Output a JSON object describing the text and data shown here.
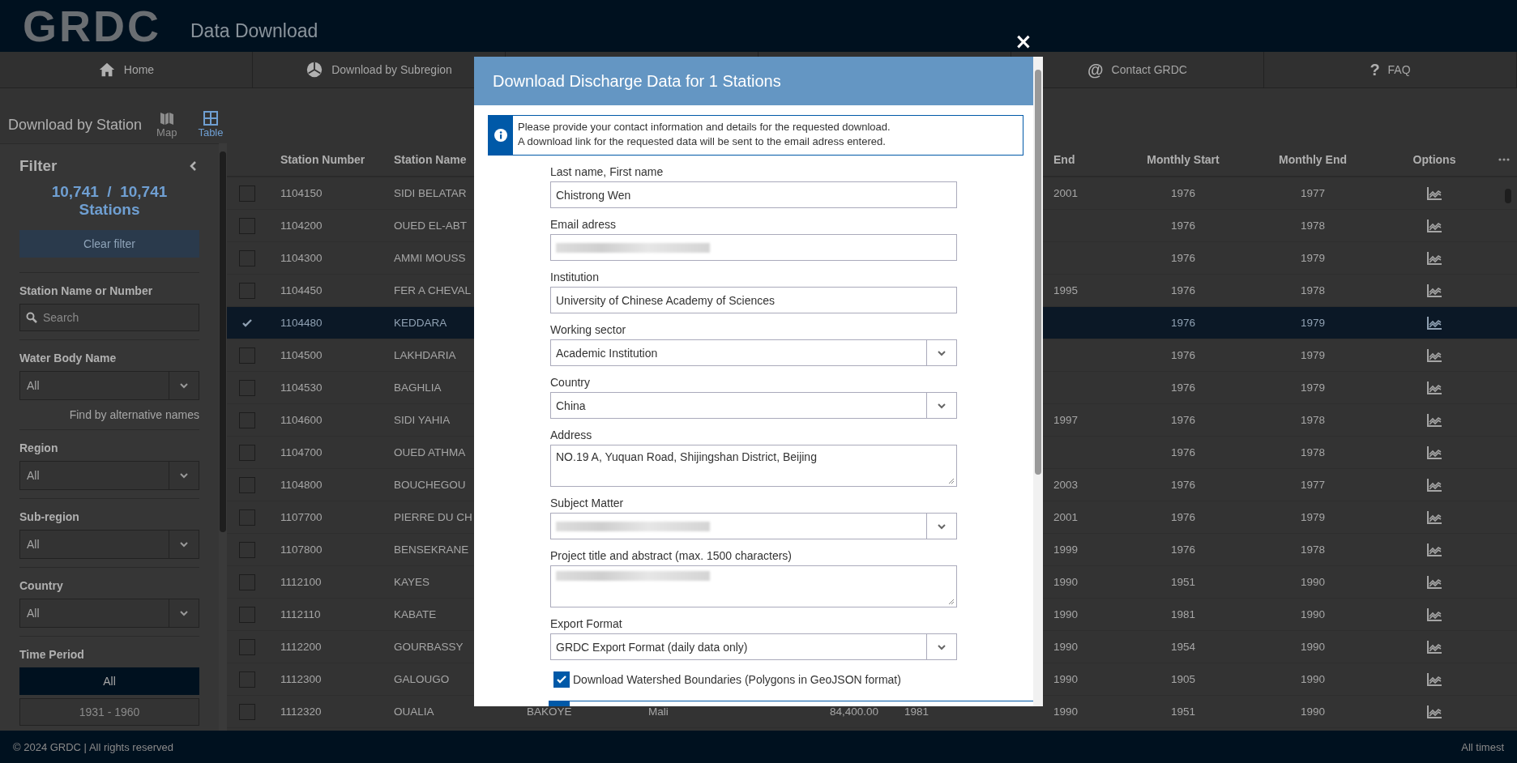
{
  "header": {
    "logo": "GRDC",
    "title": "Data Download"
  },
  "nav": {
    "left": [
      {
        "label": "Home"
      },
      {
        "label": "Download by Subregion"
      }
    ],
    "right": [
      {
        "label": "Contact GRDC",
        "icon_char": "@"
      },
      {
        "label": "FAQ",
        "icon_char": "?"
      }
    ]
  },
  "page_title": "Download by Station",
  "view_toggle": [
    {
      "label": "Map",
      "selected": false
    },
    {
      "label": "Table",
      "selected": true
    }
  ],
  "filter": {
    "title": "Filter",
    "count": "10,741  /  10,741",
    "count_unit": "Stations",
    "clear_button": {
      "label": "Clear filter",
      "disabled": true
    },
    "search": {
      "label": "Station Name or Number",
      "placeholder": "Search"
    },
    "water_body": {
      "label": "Water Body Name",
      "value": "All",
      "link": "Find by alternative names"
    },
    "region": {
      "label": "Region",
      "value": "All"
    },
    "subregion": {
      "label": "Sub-region",
      "value": "All"
    },
    "country": {
      "label": "Country",
      "value": "All"
    },
    "time_period": {
      "label": "Time Period",
      "options": [
        {
          "label": "All",
          "selected": true
        },
        {
          "label": "1931 - 1960",
          "selected": false
        }
      ]
    }
  },
  "table": {
    "columns": [
      "Station Number",
      "Station Name",
      null,
      null,
      null,
      null,
      "End",
      "Monthly Start",
      "Monthly End",
      "Options"
    ],
    "rows": [
      {
        "selected": false,
        "cells": [
          "1104150",
          "SIDI BELATAR",
          null,
          null,
          null,
          null,
          "2001",
          "1976",
          "1977"
        ]
      },
      {
        "selected": false,
        "cells": [
          "1104200",
          "OUED EL-ABT",
          null,
          null,
          null,
          null,
          null,
          "1976",
          "1978"
        ]
      },
      {
        "selected": false,
        "cells": [
          "1104300",
          "AMMI MOUSS",
          null,
          null,
          null,
          null,
          null,
          "1976",
          "1979"
        ]
      },
      {
        "selected": false,
        "cells": [
          "1104450",
          "FER A CHEVAL",
          null,
          null,
          null,
          null,
          "1995",
          "1976",
          "1978"
        ]
      },
      {
        "selected": true,
        "cells": [
          "1104480",
          "KEDDARA",
          null,
          null,
          null,
          null,
          null,
          "1976",
          "1979"
        ]
      },
      {
        "selected": false,
        "cells": [
          "1104500",
          "LAKHDARIA",
          null,
          null,
          null,
          null,
          null,
          "1976",
          "1979"
        ]
      },
      {
        "selected": false,
        "cells": [
          "1104530",
          "BAGHLIA",
          null,
          null,
          null,
          null,
          null,
          "1976",
          "1979"
        ]
      },
      {
        "selected": false,
        "cells": [
          "1104600",
          "SIDI YAHIA",
          null,
          null,
          null,
          null,
          "1997",
          "1976",
          "1978"
        ]
      },
      {
        "selected": false,
        "cells": [
          "1104700",
          "OUED ATHMA",
          null,
          null,
          null,
          null,
          null,
          "1976",
          "1978"
        ]
      },
      {
        "selected": false,
        "cells": [
          "1104800",
          "BOUCHEGOU",
          null,
          null,
          null,
          null,
          "2003",
          "1976",
          "1977"
        ]
      },
      {
        "selected": false,
        "cells": [
          "1107700",
          "PIERRE DU CH",
          null,
          null,
          null,
          null,
          "2001",
          "1976",
          "1979"
        ]
      },
      {
        "selected": false,
        "cells": [
          "1107800",
          "BENSEKRANE",
          null,
          null,
          null,
          null,
          "1999",
          "1976",
          "1978"
        ]
      },
      {
        "selected": false,
        "cells": [
          "1112100",
          "KAYES",
          null,
          null,
          null,
          null,
          "1990",
          "1951",
          "1990"
        ]
      },
      {
        "selected": false,
        "cells": [
          "1112110",
          "KABATE",
          null,
          null,
          null,
          null,
          "1990",
          "1981",
          "1990"
        ]
      },
      {
        "selected": false,
        "cells": [
          "1112200",
          "GOURBASSY",
          null,
          null,
          null,
          null,
          "1990",
          "1954",
          "1990"
        ]
      },
      {
        "selected": false,
        "cells": [
          "1112300",
          "GALOUGO",
          null,
          null,
          null,
          null,
          "1990",
          "1905",
          "1990"
        ]
      },
      {
        "selected": false,
        "cells": [
          "1112320",
          "OUALIA",
          "BAKOYE",
          "Mali",
          "84,400.00",
          "1981",
          "1990",
          "1951",
          "1990"
        ]
      }
    ]
  },
  "footer": {
    "copyright": "© 2024 GRDC | All rights reserved",
    "note": "All timest"
  },
  "modal": {
    "title": "Download Discharge Data for 1 Stations",
    "close": "×",
    "info": [
      "Please provide your contact information and details for the requested download.",
      "A download link for the requested data will be sent to the email adress entered."
    ],
    "fields": [
      {
        "kind": "input",
        "label": "Last name, First name",
        "value": "Chistrong Wen"
      },
      {
        "kind": "input",
        "label": "Email adress",
        "blurred": true
      },
      {
        "kind": "input",
        "label": "Institution",
        "value": "University of Chinese Academy of Sciences"
      },
      {
        "kind": "select",
        "label": "Working sector",
        "value": "Academic Institution"
      },
      {
        "kind": "select",
        "label": "Country",
        "value": "China"
      },
      {
        "kind": "textarea",
        "label": "Address",
        "value": "NO.19 A, Yuquan Road, Shijingshan District, Beijing"
      },
      {
        "kind": "select",
        "label": "Subject Matter",
        "blurred": true
      },
      {
        "kind": "textarea",
        "label": "Project title and abstract (max. 1500 characters)",
        "blurred": true
      },
      {
        "kind": "select",
        "label": "Export Format",
        "value": "GRDC Export Format (daily data only)"
      }
    ],
    "checkbox": {
      "label": "Download Watershed Boundaries (Polygons in GeoJSON format)",
      "checked": true
    }
  }
}
